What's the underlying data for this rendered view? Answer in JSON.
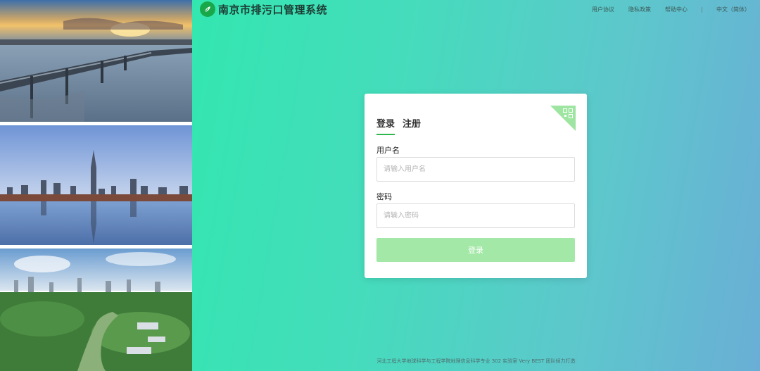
{
  "header": {
    "title": "南京市排污口管理系统",
    "nav": {
      "user_agreement": "用户协议",
      "privacy_policy": "隐私政策",
      "help_center": "帮助中心",
      "language": "中文（简体）"
    }
  },
  "login": {
    "tabs": {
      "login": "登录",
      "register": "注册"
    },
    "username_label": "用户名",
    "username_placeholder": "请输入用户名",
    "username_value": "",
    "password_label": "密码",
    "password_placeholder": "请输入密码",
    "password_value": "",
    "submit_label": "登录"
  },
  "footer": {
    "text": "河北工程大学地球科学与工程学院地理信息科学专业 302 实验室 Very BEST 团队倾力打造"
  },
  "colors": {
    "brand_green": "#2eb84c",
    "button_green": "#a3e8a7",
    "gradient_start": "#33e6b0",
    "gradient_end": "#6aaed6"
  }
}
